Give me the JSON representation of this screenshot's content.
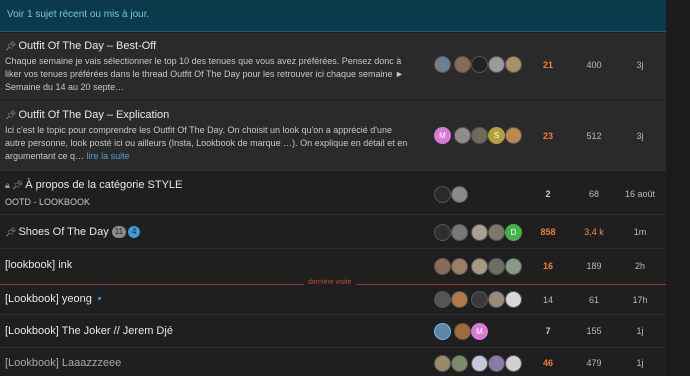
{
  "banner": {
    "text": "Voir 1 sujet récent ou mis à jour."
  },
  "divider_label": "dernière visite",
  "topics": [
    {
      "title": "Outfit Of The Day – Best-Off",
      "excerpt": "Chaque semaine je vais sélectionner le top 10 des tenues que vous avez préférées. Pensez donc à liker vos tenues préférées dans le thread Outfit Of The Day pour les retrouver ici chaque semaine ► Semaine du 14 au 20 septe…",
      "replies": "21",
      "views": "400",
      "activity": "3j"
    },
    {
      "title": "Outfit Of The Day – Explication",
      "excerpt": "Ici c'est le topic pour comprendre les Outfit Of The Day. On choisit un look qu'on a apprécié d'une autre personne, look posté ici ou ailleurs (Insta, Lookbook de marque …). On explique en détail et en argumentant ce q…",
      "read_more": "lire la suite",
      "replies": "23",
      "views": "512",
      "activity": "3j"
    },
    {
      "title": "À propos de la catégorie STYLE",
      "tag": "OOTD - LOOKBOOK",
      "replies": "2",
      "views": "68",
      "activity": "16 août"
    },
    {
      "title": "Shoes Of The Day",
      "badge_count": "11",
      "new_count": "4",
      "replies": "858",
      "views": "3,4 k",
      "activity": "1m"
    },
    {
      "title": "[lookbook] ink",
      "replies": "16",
      "views": "189",
      "activity": "2h"
    },
    {
      "title": "[Lookbook] yeong",
      "replies": "14",
      "views": "61",
      "activity": "17h"
    },
    {
      "title": "[Lookbook] The Joker // Jerem Djé",
      "replies": "7",
      "views": "155",
      "activity": "1j"
    },
    {
      "title": "[Lookbook] Laaazzzeee",
      "replies": "46",
      "views": "479",
      "activity": "1j"
    }
  ],
  "avatar_letters": [
    "M",
    "S",
    "D",
    "M"
  ],
  "colors": {
    "banner_bg": "#0b3a4c",
    "hot": "#f0802f",
    "link": "#4aa3d9",
    "divider": "#8a3b2a"
  }
}
